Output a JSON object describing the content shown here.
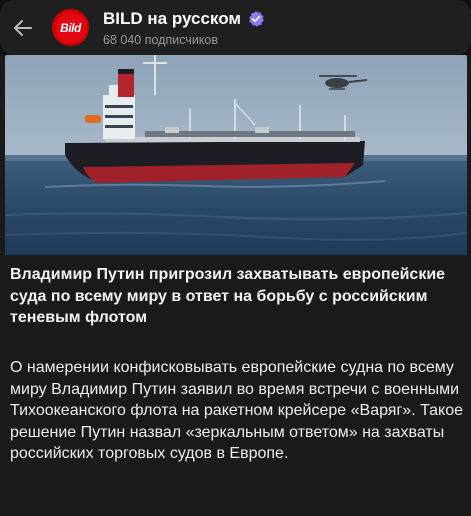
{
  "header": {
    "channel_name": "BILD на русском",
    "subscribers": "68 040 подписчиков",
    "avatar_text": "Bild",
    "back_icon": "arrow-left-icon",
    "verified_icon": "verified-badge-icon"
  },
  "post": {
    "title": "Владимир Путин пригрозил захватывать европейские суда по всему миру в ответ на борьбу с российским теневым флотом",
    "body": "О намерении конфисковывать европейские судна по всему миру Владимир Путин заявил во время встречи с военными Тихоокеанского флота на ракетном крейсере «Варяг». Такое решение Путин назвал «зеркальным ответом» на захваты российских торговых судов в Европе.",
    "image_alt": "tanker-ship-photo"
  },
  "colors": {
    "header_bg": "#1f1f1f",
    "card_bg": "#1a1a1a",
    "brand_red": "#e30613",
    "verified_purple": "#8b7cf6"
  }
}
